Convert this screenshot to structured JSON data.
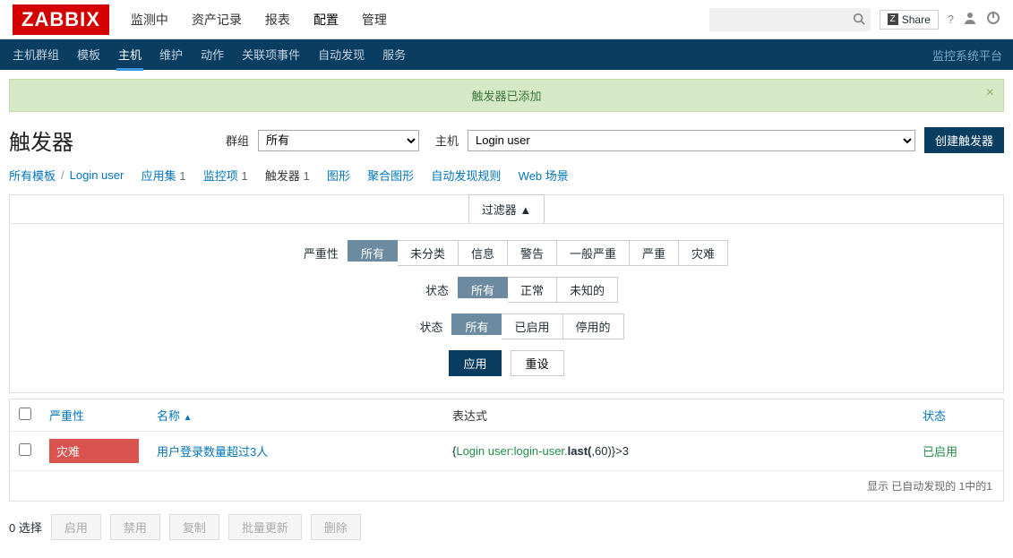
{
  "logo": "ZABBIX",
  "topnav": {
    "items": [
      "监测中",
      "资产记录",
      "报表",
      "配置",
      "管理"
    ],
    "active_index": 3,
    "share": "Share",
    "search_placeholder": ""
  },
  "subnav": {
    "items": [
      "主机群组",
      "模板",
      "主机",
      "维护",
      "动作",
      "关联项事件",
      "自动发现",
      "服务"
    ],
    "active_index": 2,
    "right_text": "监控系统平台"
  },
  "alert": {
    "message": "触发器已添加"
  },
  "page": {
    "title": "触发器",
    "group_label": "群组",
    "group_value": "所有",
    "host_label": "主机",
    "host_value": "Login user",
    "create_button": "创建触发器"
  },
  "breadcrumb": {
    "all_templates": "所有模板",
    "host": "Login user",
    "items": [
      {
        "label": "应用集",
        "count": "1"
      },
      {
        "label": "监控项",
        "count": "1"
      },
      {
        "label": "触发器",
        "count": "1",
        "active": true
      },
      {
        "label": "图形",
        "count": ""
      },
      {
        "label": "聚合图形",
        "count": ""
      },
      {
        "label": "自动发现规则",
        "count": ""
      },
      {
        "label": "Web 场景",
        "count": ""
      }
    ]
  },
  "filter": {
    "tab_label": "过滤器 ▲",
    "rows": [
      {
        "label": "严重性",
        "options": [
          "所有",
          "未分类",
          "信息",
          "警告",
          "一般严重",
          "严重",
          "灾难"
        ],
        "selected": 0
      },
      {
        "label": "状态",
        "options": [
          "所有",
          "正常",
          "未知的"
        ],
        "selected": 0
      },
      {
        "label": "状态",
        "options": [
          "所有",
          "已启用",
          "停用的"
        ],
        "selected": 0
      }
    ],
    "apply": "应用",
    "reset": "重设"
  },
  "table": {
    "headers": {
      "severity": "严重性",
      "name": "名称",
      "expression": "表达式",
      "status": "状态"
    },
    "rows": [
      {
        "severity": "灾难",
        "name": "用户登录数量超过3人",
        "expr_prefix": "{",
        "expr_link": "Login user:login-user.",
        "expr_bold": "last(",
        "expr_tail": ",60)}>3",
        "status": "已启用"
      }
    ],
    "footer": "显示 已自动发现的 1中的1"
  },
  "bottom": {
    "selected": "0 选择",
    "buttons": [
      "启用",
      "禁用",
      "复制",
      "批量更新",
      "删除"
    ]
  }
}
